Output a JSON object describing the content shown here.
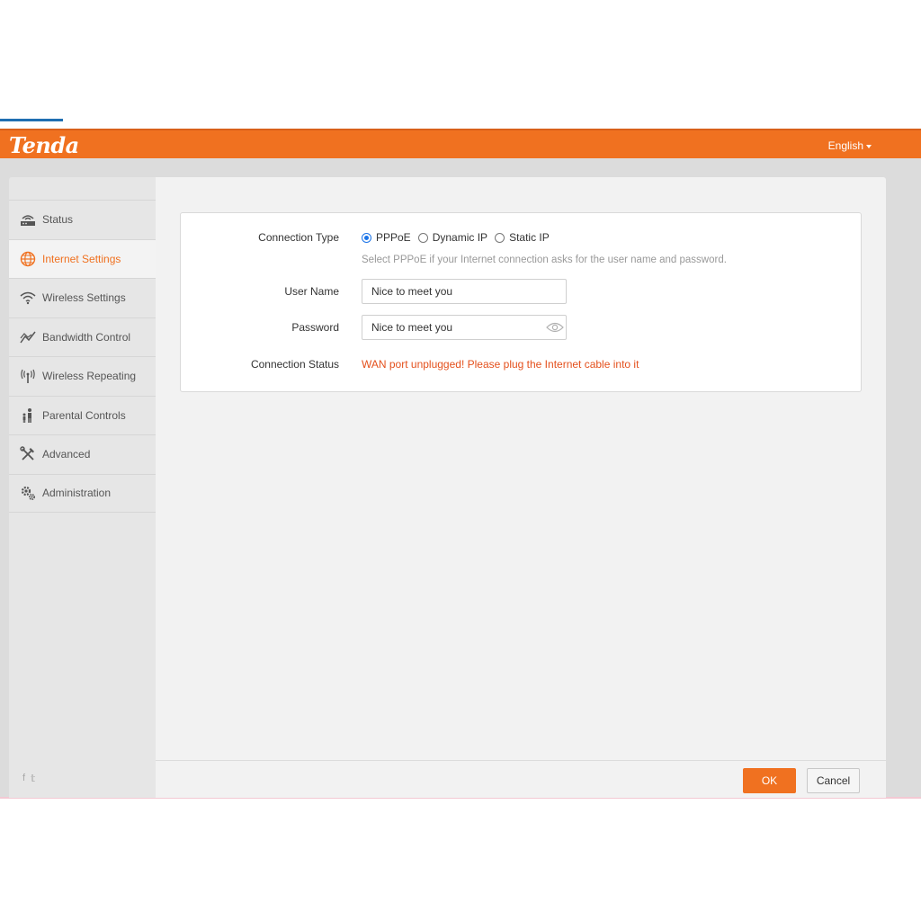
{
  "header": {
    "logo_text": "Tenda",
    "language": "English"
  },
  "sidebar": {
    "items": [
      {
        "label": "Status",
        "icon": "router-icon"
      },
      {
        "label": "Internet Settings",
        "icon": "globe-icon",
        "active": true
      },
      {
        "label": "Wireless Settings",
        "icon": "wifi-icon"
      },
      {
        "label": "Bandwidth Control",
        "icon": "bandwidth-icon"
      },
      {
        "label": "Wireless Repeating",
        "icon": "antenna-icon"
      },
      {
        "label": "Parental Controls",
        "icon": "family-icon"
      },
      {
        "label": "Advanced",
        "icon": "tools-icon"
      },
      {
        "label": "Administration",
        "icon": "gear-icon"
      }
    ],
    "social": {
      "facebook": "f",
      "twitter": "𝕥"
    }
  },
  "form": {
    "connection_type": {
      "label": "Connection Type",
      "options": [
        "PPPoE",
        "Dynamic IP",
        "Static IP"
      ],
      "selected": "PPPoE",
      "hint": "Select PPPoE if your Internet connection asks for the user name and password."
    },
    "user_name": {
      "label": "User Name",
      "value": "Nice to meet you"
    },
    "password": {
      "label": "Password",
      "value": "Nice to meet you"
    },
    "connection_status": {
      "label": "Connection Status",
      "value": "WAN port unplugged! Please plug the Internet cable into it"
    }
  },
  "footer": {
    "ok_label": "OK",
    "cancel_label": "Cancel"
  },
  "colors": {
    "brand": "#f07120",
    "status_error": "#e4501c",
    "radio_selected": "#1a73e8"
  }
}
